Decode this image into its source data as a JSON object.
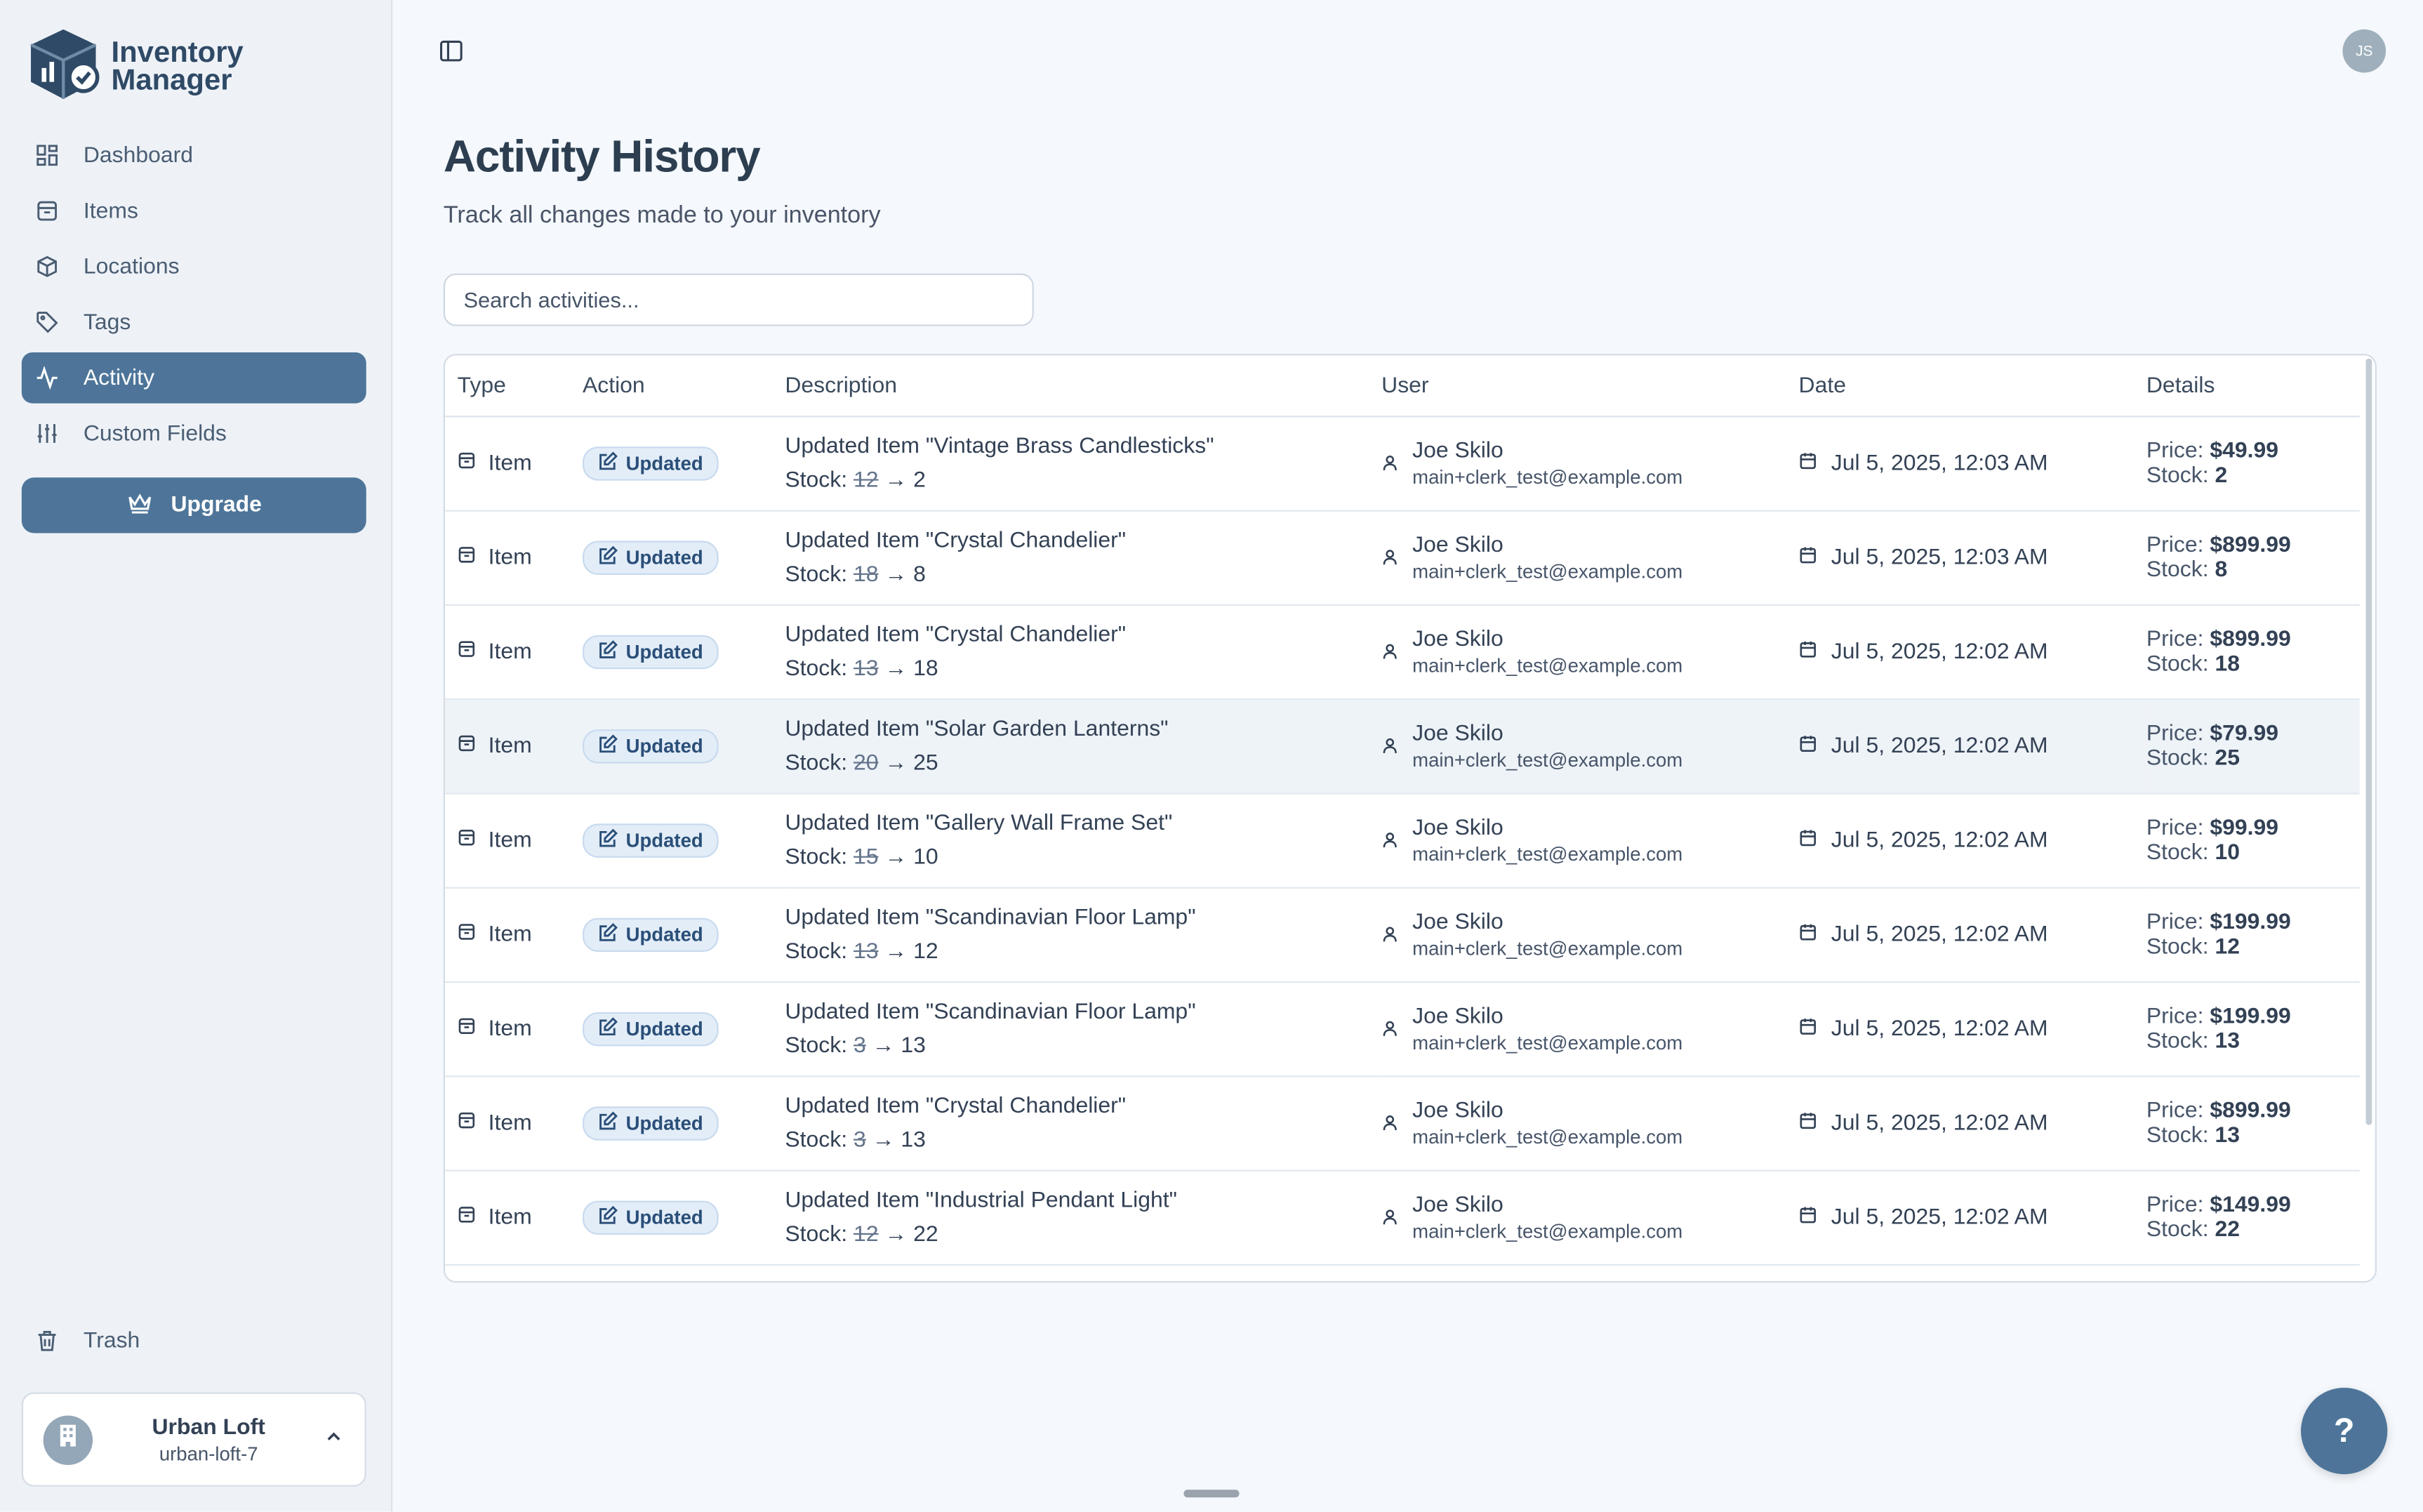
{
  "app": {
    "logo_line1": "Inventory",
    "logo_line2": "Manager",
    "accent": "#4e7599"
  },
  "sidebar": {
    "items": [
      {
        "label": "Dashboard",
        "icon": "dashboard-icon"
      },
      {
        "label": "Items",
        "icon": "box-icon"
      },
      {
        "label": "Locations",
        "icon": "cube-icon"
      },
      {
        "label": "Tags",
        "icon": "tag-icon"
      },
      {
        "label": "Activity",
        "icon": "activity-icon",
        "active": true
      },
      {
        "label": "Custom Fields",
        "icon": "sliders-icon"
      }
    ],
    "upgrade_label": "Upgrade",
    "trash_label": "Trash",
    "org": {
      "name": "Urban Loft",
      "slug": "urban-loft-7"
    }
  },
  "header": {
    "avatar_initials": "JS"
  },
  "page": {
    "title": "Activity History",
    "subtitle": "Track all changes made to your inventory",
    "search_placeholder": "Search activities..."
  },
  "table": {
    "columns": [
      "Type",
      "Action",
      "Description",
      "User",
      "Date",
      "Details"
    ],
    "price_label": "Price:",
    "stock_label": "Stock:",
    "rows": [
      {
        "type": "Item",
        "action": "Updated",
        "description": "Updated Item \"Vintage Brass Candlesticks\"",
        "stock_old": "12",
        "stock_new": "2",
        "user": "Joe Skilo",
        "email": "main+clerk_test@example.com",
        "date": "Jul 5, 2025, 12:03 AM",
        "price": "$49.99",
        "stock": "2"
      },
      {
        "type": "Item",
        "action": "Updated",
        "description": "Updated Item \"Crystal Chandelier\"",
        "stock_old": "18",
        "stock_new": "8",
        "user": "Joe Skilo",
        "email": "main+clerk_test@example.com",
        "date": "Jul 5, 2025, 12:03 AM",
        "price": "$899.99",
        "stock": "8"
      },
      {
        "type": "Item",
        "action": "Updated",
        "description": "Updated Item \"Crystal Chandelier\"",
        "stock_old": "13",
        "stock_new": "18",
        "user": "Joe Skilo",
        "email": "main+clerk_test@example.com",
        "date": "Jul 5, 2025, 12:02 AM",
        "price": "$899.99",
        "stock": "18"
      },
      {
        "type": "Item",
        "action": "Updated",
        "description": "Updated Item \"Solar Garden Lanterns\"",
        "stock_old": "20",
        "stock_new": "25",
        "user": "Joe Skilo",
        "email": "main+clerk_test@example.com",
        "date": "Jul 5, 2025, 12:02 AM",
        "price": "$79.99",
        "stock": "25",
        "highlight": true
      },
      {
        "type": "Item",
        "action": "Updated",
        "description": "Updated Item \"Gallery Wall Frame Set\"",
        "stock_old": "15",
        "stock_new": "10",
        "user": "Joe Skilo",
        "email": "main+clerk_test@example.com",
        "date": "Jul 5, 2025, 12:02 AM",
        "price": "$99.99",
        "stock": "10"
      },
      {
        "type": "Item",
        "action": "Updated",
        "description": "Updated Item \"Scandinavian Floor Lamp\"",
        "stock_old": "13",
        "stock_new": "12",
        "user": "Joe Skilo",
        "email": "main+clerk_test@example.com",
        "date": "Jul 5, 2025, 12:02 AM",
        "price": "$199.99",
        "stock": "12"
      },
      {
        "type": "Item",
        "action": "Updated",
        "description": "Updated Item \"Scandinavian Floor Lamp\"",
        "stock_old": "3",
        "stock_new": "13",
        "user": "Joe Skilo",
        "email": "main+clerk_test@example.com",
        "date": "Jul 5, 2025, 12:02 AM",
        "price": "$199.99",
        "stock": "13"
      },
      {
        "type": "Item",
        "action": "Updated",
        "description": "Updated Item \"Crystal Chandelier\"",
        "stock_old": "3",
        "stock_new": "13",
        "user": "Joe Skilo",
        "email": "main+clerk_test@example.com",
        "date": "Jul 5, 2025, 12:02 AM",
        "price": "$899.99",
        "stock": "13"
      },
      {
        "type": "Item",
        "action": "Updated",
        "description": "Updated Item \"Industrial Pendant Light\"",
        "stock_old": "12",
        "stock_new": "22",
        "user": "Joe Skilo",
        "email": "main+clerk_test@example.com",
        "date": "Jul 5, 2025, 12:02 AM",
        "price": "$149.99",
        "stock": "22"
      }
    ]
  },
  "help_label": "?"
}
